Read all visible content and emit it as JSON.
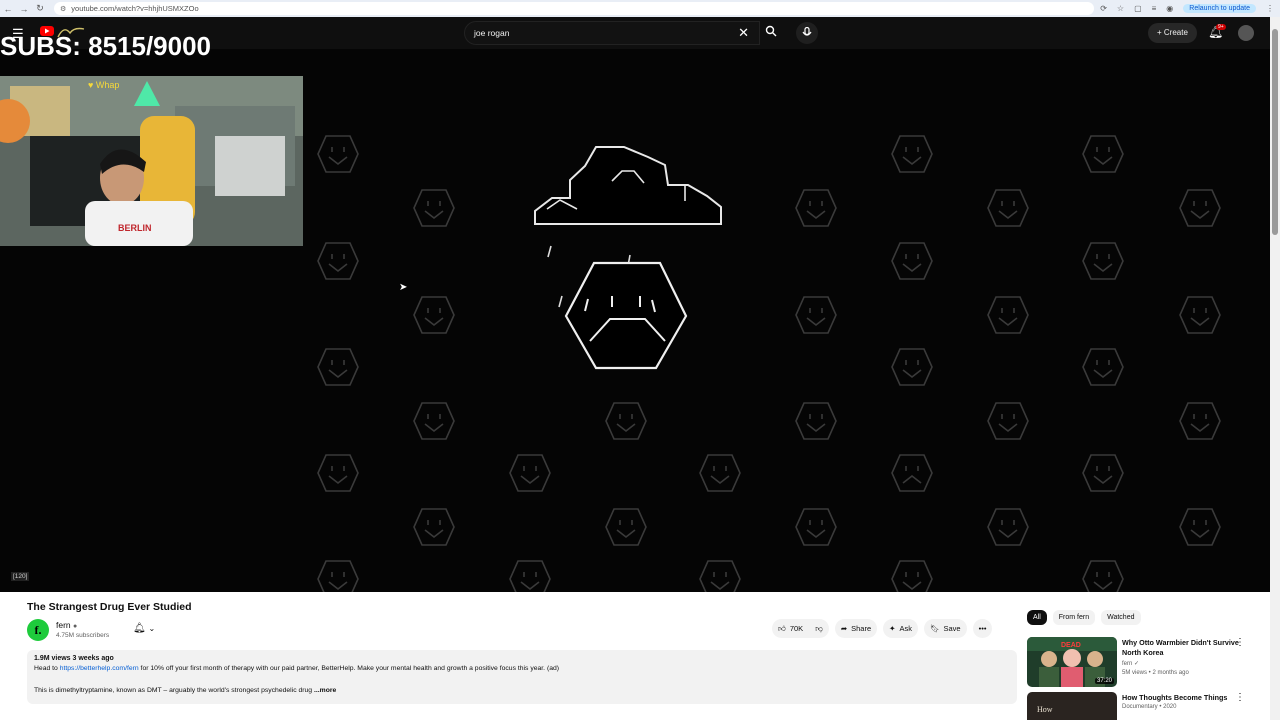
{
  "browser": {
    "url": "youtube.com/watch?v=hhjhUSMXZOo",
    "relaunch_label": "Relaunch to update"
  },
  "topbar": {
    "search_query": "joe rogan",
    "create_label": "Create",
    "notification_badge": "9+"
  },
  "overlay": {
    "subs_text": "SUBS: 8515/9000",
    "frame_counter": "[120]"
  },
  "video": {
    "title": "The Strangest Drug Ever Studied",
    "channel": {
      "name": "fern",
      "subscribers": "4.75M subscribers",
      "avatar_letter": "f."
    },
    "actions": {
      "likes": "70K",
      "share": "Share",
      "ask": "Ask",
      "save": "Save"
    },
    "description": {
      "meta": "1.9M views  3 weeks ago",
      "line1_prefix": "Head to ",
      "line1_link": "https://betterhelp.com/fern",
      "line1_suffix": " for 10% off your first month of therapy with our paid partner, BetterHelp. Make your mental health and growth a positive focus this year. (ad)",
      "line2": "This is dimethyltryptamine, known as DMT – arguably the world's strongest psychedelic drug",
      "more": "...more"
    }
  },
  "sidebar": {
    "chips": [
      "All",
      "From fern",
      "Watched"
    ],
    "recommendations": [
      {
        "title": "Why Otto Warmbier Didn't Survive North Korea",
        "channel": "fern",
        "meta": "5M views • 2 months ago",
        "duration": "37:20"
      },
      {
        "title": "How Thoughts Become Things",
        "channel": "Documentary • 2020",
        "meta": "",
        "duration": ""
      }
    ]
  },
  "colors": {
    "yt_background": "#0f0f0f",
    "accent_red": "#cc0000",
    "link_blue": "#065fd4",
    "channel_green": "#1ecb3c"
  }
}
